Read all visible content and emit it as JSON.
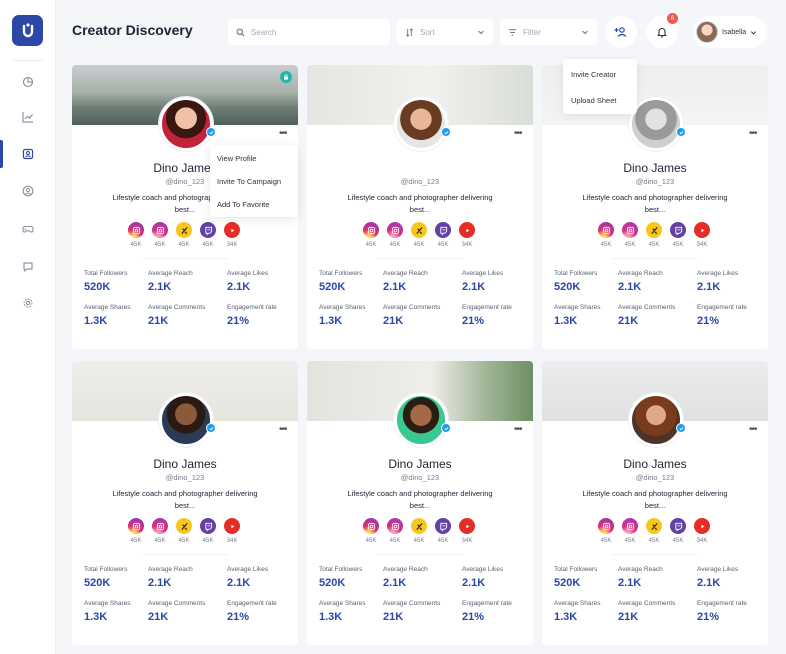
{
  "page": {
    "title": "Creator Discovery"
  },
  "search": {
    "placeholder": "Search"
  },
  "sort": {
    "label": "Sort"
  },
  "filter": {
    "label": "Filter"
  },
  "notifications": {
    "count": "6"
  },
  "user": {
    "name": "Isabella"
  },
  "add_menu": [
    "Invite Creator",
    "Upload Sheet"
  ],
  "card_menu": [
    "View Profile",
    "Invite To Campaign",
    "Add To Favorite"
  ],
  "sidebar": {
    "items": [
      {
        "icon": "pie-chart-icon"
      },
      {
        "icon": "line-chart-icon"
      },
      {
        "icon": "contact-card-icon",
        "active": true
      },
      {
        "icon": "user-circle-icon"
      },
      {
        "icon": "gamepad-icon"
      },
      {
        "icon": "chat-bubble-icon"
      },
      {
        "icon": "gear-icon"
      }
    ]
  },
  "stat_labels": [
    "Total Followers",
    "Average Reach",
    "Average  Likes",
    "Average Shares",
    "Average Comments",
    "Engagement rate"
  ],
  "creators": [
    {
      "name": "Dino James",
      "handle": "@dino_123",
      "bio": "Lifestyle coach and photographer delivering best...",
      "socials": [
        "45K",
        "45K",
        "45K",
        "45K",
        "34K"
      ],
      "stats": [
        "520K",
        "2.1K",
        "2.1K",
        "1.3K",
        "21K",
        "21%"
      ]
    },
    {
      "name": "",
      "handle": "@dino_123",
      "bio": "Lifestyle coach and photographer delivering best...",
      "socials": [
        "45K",
        "45K",
        "45K",
        "45K",
        "34K"
      ],
      "stats": [
        "520K",
        "2.1K",
        "2.1K",
        "1.3K",
        "21K",
        "21%"
      ]
    },
    {
      "name": "Dino James",
      "handle": "@dino_123",
      "bio": "Lifestyle coach and photographer delivering best...",
      "socials": [
        "45K",
        "45K",
        "45K",
        "45K",
        "34K"
      ],
      "stats": [
        "520K",
        "2.1K",
        "2.1K",
        "1.3K",
        "21K",
        "21%"
      ]
    },
    {
      "name": "Dino James",
      "handle": "@dino_123",
      "bio": "Lifestyle coach and photographer delivering best...",
      "socials": [
        "45K",
        "45K",
        "45K",
        "45K",
        "34K"
      ],
      "stats": [
        "520K",
        "2.1K",
        "2.1K",
        "1.3K",
        "21K",
        "21%"
      ]
    },
    {
      "name": "Dino James",
      "handle": "@dino_123",
      "bio": "Lifestyle coach and photographer delivering best...",
      "socials": [
        "45K",
        "45K",
        "45K",
        "45K",
        "34K"
      ],
      "stats": [
        "520K",
        "2.1K",
        "2.1K",
        "1.3K",
        "21K",
        "21%"
      ]
    },
    {
      "name": "Dino James",
      "handle": "@dino_123",
      "bio": "Lifestyle coach and photographer delivering best...",
      "socials": [
        "45K",
        "45K",
        "45K",
        "45K",
        "34K"
      ],
      "stats": [
        "520K",
        "2.1K",
        "2.1K",
        "1.3K",
        "21K",
        "21%"
      ]
    }
  ],
  "social_platforms": [
    "instagram-icon",
    "instagram-icon",
    "kick-icon",
    "twitch-icon",
    "youtube-icon"
  ],
  "colors": {
    "accent": "#2b47a8",
    "verified": "#1d9bf0",
    "badge": "#f05a55",
    "lock": "#22b8a6"
  }
}
